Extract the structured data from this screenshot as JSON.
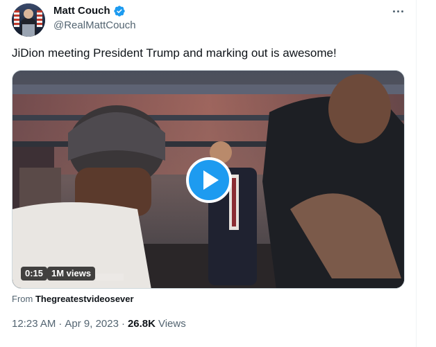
{
  "author": {
    "display_name": "Matt Couch",
    "handle": "@RealMattCouch",
    "verified": true
  },
  "tweet": {
    "text": "JiDion meeting President Trump and marking out is awesome!"
  },
  "media": {
    "duration": "0:15",
    "views_badge": "1M views",
    "play_label": "Play video"
  },
  "source": {
    "prefix": "From",
    "account": "Thegreatestvideosever"
  },
  "meta": {
    "time": "12:23 AM",
    "separator1": "·",
    "date": "Apr 9, 2023",
    "separator2": "·",
    "views_count": "26.8K",
    "views_label": "Views"
  },
  "colors": {
    "accent": "#1d9bf0",
    "text_primary": "#0f1419",
    "text_secondary": "#536471"
  },
  "icons": {
    "verified": "verified-badge-icon",
    "more": "more-options-icon",
    "play": "play-icon"
  }
}
